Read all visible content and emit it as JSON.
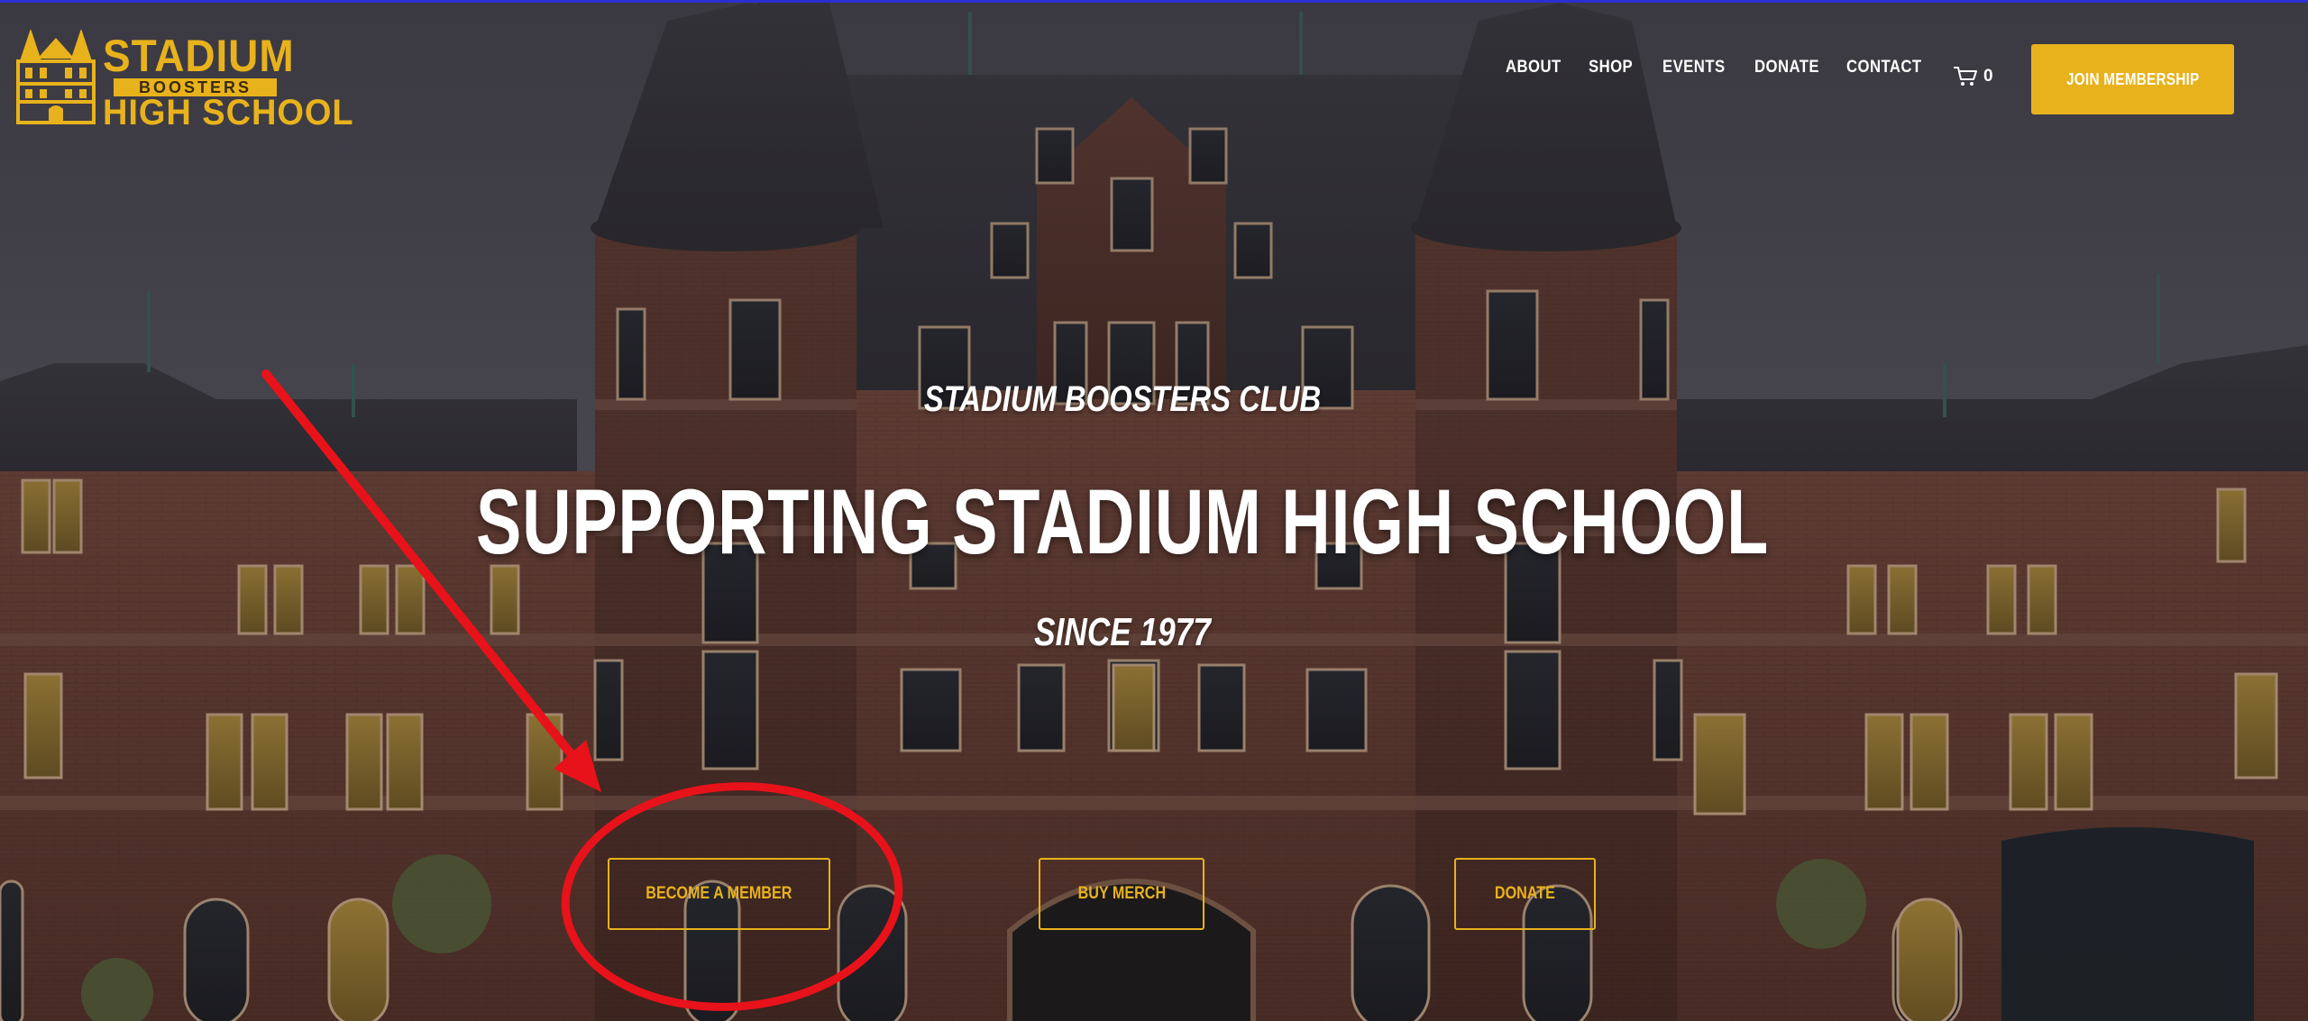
{
  "logo": {
    "line1": "STADIUM",
    "line2": "BOOSTERS",
    "line3": "HIGH SCHOOL"
  },
  "nav": {
    "items": [
      {
        "label": "ABOUT"
      },
      {
        "label": "SHOP"
      },
      {
        "label": "EVENTS"
      },
      {
        "label": "DONATE"
      },
      {
        "label": "CONTACT"
      }
    ],
    "cart_count": "0",
    "join_label": "JOIN MEMBERSHIP"
  },
  "hero": {
    "eyebrow": "STADIUM BOOSTERS CLUB",
    "title": "SUPPORTING STADIUM HIGH SCHOOL",
    "since": "SINCE 1977"
  },
  "cta": {
    "member": "BECOME A MEMBER",
    "merch": "BUY MERCH",
    "donate": "DONATE"
  },
  "colors": {
    "accent": "#e8b21c",
    "annotation": "#e8121a",
    "text": "#ffffff"
  }
}
